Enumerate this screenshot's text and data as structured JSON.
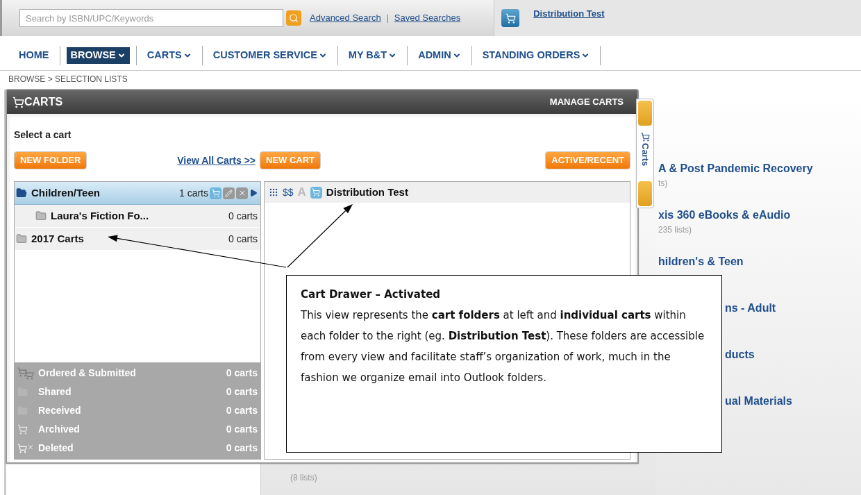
{
  "search": {
    "placeholder": "Search by ISBN/UPC/Keywords"
  },
  "top_links": [
    {
      "label": "Advanced Search"
    },
    {
      "label": "Saved Searches"
    }
  ],
  "link_separator": "|",
  "active_cart": {
    "name": "Distribution Test"
  },
  "nav": [
    {
      "label": "HOME",
      "selected": false,
      "dropdown": false
    },
    {
      "label": "BROWSE",
      "selected": true,
      "dropdown": true
    },
    {
      "label": "CARTS",
      "selected": false,
      "dropdown": true
    },
    {
      "label": "CUSTOMER SERVICE",
      "selected": false,
      "dropdown": true
    },
    {
      "label": "MY B&T",
      "selected": false,
      "dropdown": true
    },
    {
      "label": "ADMIN",
      "selected": false,
      "dropdown": true
    },
    {
      "label": "STANDING ORDERS",
      "selected": false,
      "dropdown": true
    }
  ],
  "breadcrumb": "BROWSE > SELECTION LISTS",
  "background_lists": [
    {
      "title": "A & Post Pandemic Recovery",
      "count": "ts)"
    },
    {
      "title": "xis 360 eBooks & eAudio",
      "count": "235 lists)"
    },
    {
      "title": "hildren's & Teen"
    },
    {
      "title": "ns - Adult"
    },
    {
      "title": "ducts"
    },
    {
      "title": "ual Materials"
    }
  ],
  "middle_count": "(8 lists)",
  "drawer": {
    "title": "CARTS",
    "manage": "MANAGE CARTS",
    "tab_label": "Carts",
    "prompt": "Select a cart",
    "new_folder": "NEW FOLDER",
    "view_all": "View All Carts >>",
    "new_cart": "NEW CART",
    "active_recent": "ACTIVE/RECENT",
    "folders": [
      {
        "name": "Children/Teen",
        "count": "1 carts",
        "selected": true,
        "expanded": true,
        "children": [
          {
            "name": "Laura's Fiction Fo...",
            "count": "0 carts",
            "selected": false,
            "expanded": false
          }
        ]
      },
      {
        "name": "2017 Carts",
        "count": "0 carts",
        "selected": false,
        "expanded": false
      }
    ],
    "system_folders": [
      {
        "kind": "ordered",
        "name": "Ordered & Submitted",
        "count": "0 carts"
      },
      {
        "kind": "shared",
        "name": "Shared",
        "count": "0 carts"
      },
      {
        "kind": "received",
        "name": "Received",
        "count": "0 carts"
      },
      {
        "kind": "archived",
        "name": "Archived",
        "count": "0 carts"
      },
      {
        "kind": "deleted",
        "name": "Deleted",
        "count": "0 carts"
      }
    ],
    "carts": [
      {
        "name": "Distribution Test",
        "price_mark": "$$",
        "letter_mark": "A"
      }
    ]
  },
  "callout": {
    "title": "Cart Drawer – Activated",
    "body": "This view represents the **cart folders** at left and **individual carts** within each folder to the right (eg. **Distribution Test**). These folders are accessible from every view and facilitate staff’s organization of work, much in the fashion we organize email into Outlook folders."
  }
}
